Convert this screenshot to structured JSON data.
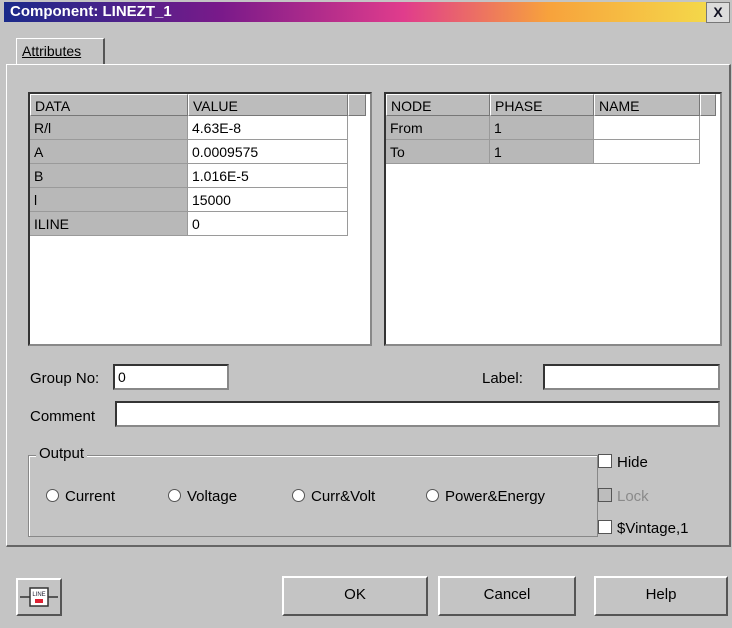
{
  "window": {
    "title": "Component: LINEZT_1",
    "close_glyph": "X"
  },
  "tabs": [
    {
      "label": "Attributes"
    }
  ],
  "data_table": {
    "headers": [
      "DATA",
      "VALUE"
    ],
    "rows": [
      [
        "R/l",
        "4.63E-8"
      ],
      [
        "A",
        "0.0009575"
      ],
      [
        "B",
        "1.016E-5"
      ],
      [
        "l",
        "15000"
      ],
      [
        "ILINE",
        "0"
      ]
    ]
  },
  "node_table": {
    "headers": [
      "NODE",
      "PHASE",
      "NAME"
    ],
    "rows": [
      [
        "From",
        "1",
        ""
      ],
      [
        "To",
        "1",
        ""
      ]
    ]
  },
  "group_no": {
    "label": "Group No:",
    "value": "0"
  },
  "label_field": {
    "label": "Label:",
    "value": ""
  },
  "comment": {
    "label": "Comment",
    "value": ""
  },
  "output": {
    "title": "Output",
    "options": [
      "Current",
      "Voltage",
      "Curr&Volt",
      "Power&Energy"
    ]
  },
  "checks": {
    "hide": "Hide",
    "lock": "Lock",
    "vintage": "$Vintage,1"
  },
  "buttons": {
    "ok": "OK",
    "cancel": "Cancel",
    "help": "Help"
  },
  "icon_button": {
    "icon": "line-component-icon",
    "text": "LINE"
  }
}
